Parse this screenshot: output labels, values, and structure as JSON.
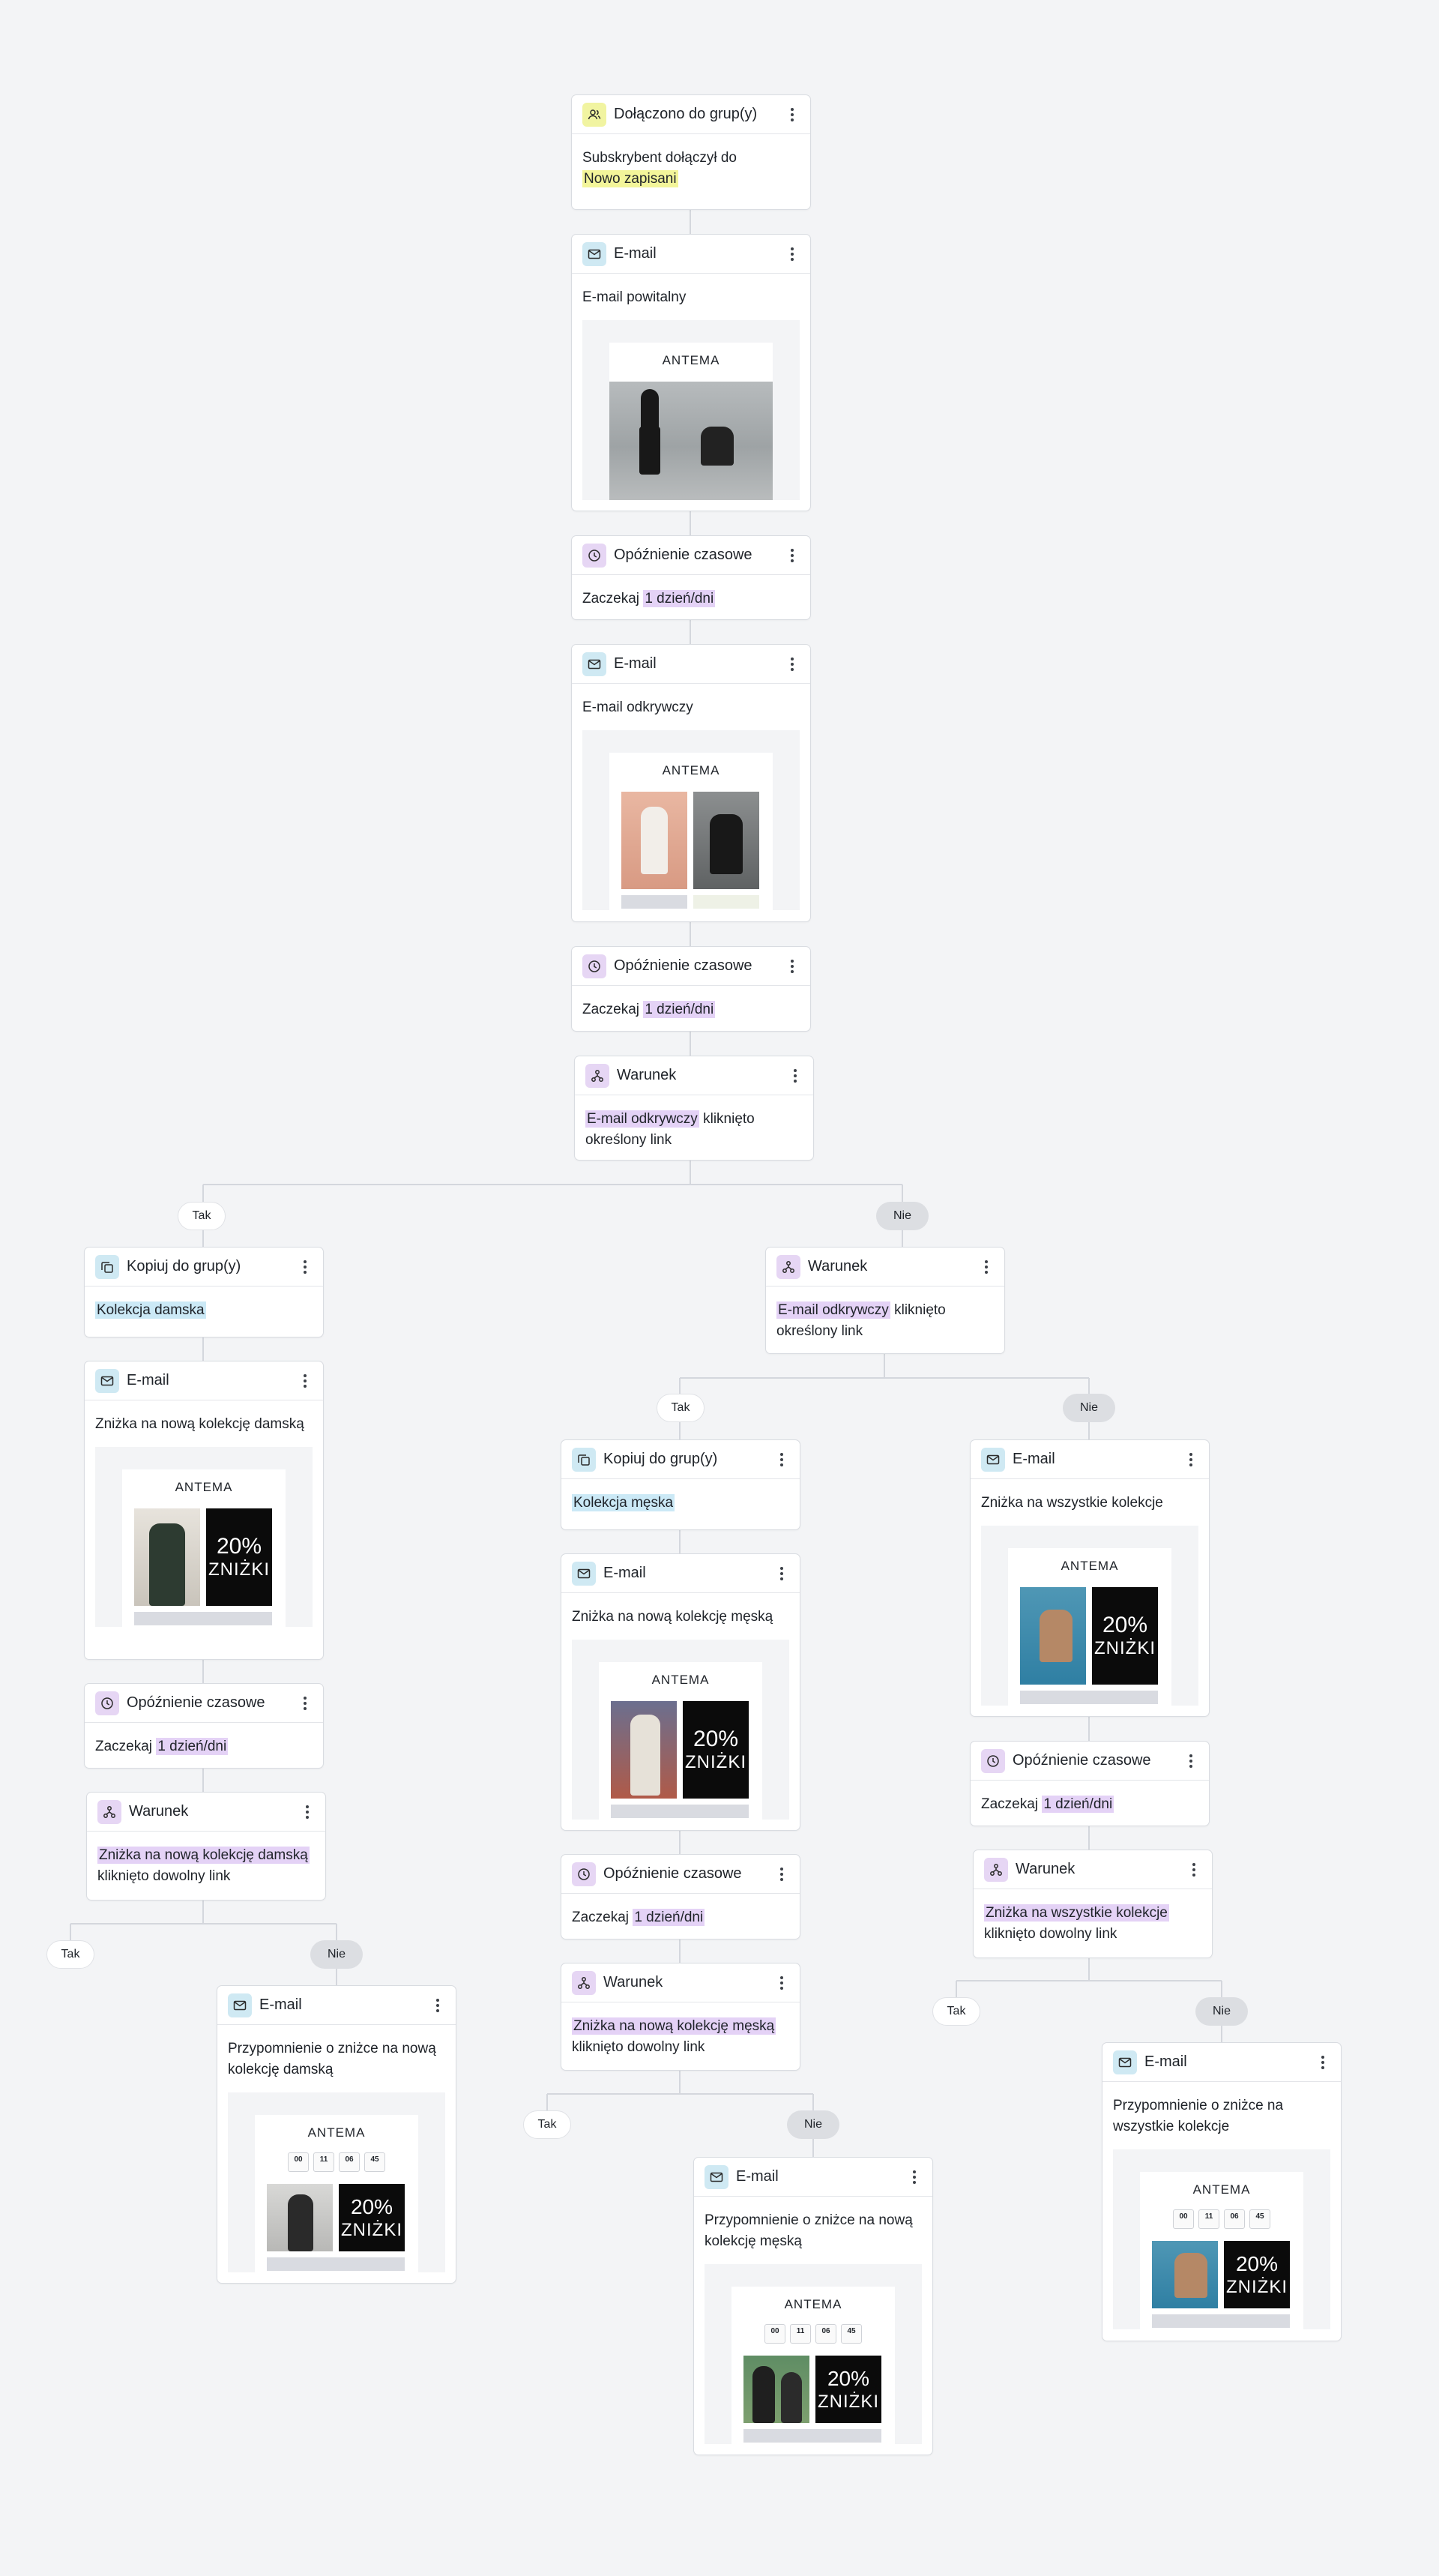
{
  "brand": "ANTEMA",
  "promo": {
    "value": "20%",
    "label": "ZNIŻKI"
  },
  "timer": [
    "00",
    "11",
    "06",
    "45"
  ],
  "branch": {
    "yes": "Tak",
    "no": "Nie"
  },
  "nodes": {
    "n1": {
      "title": "Dołączono do grup(y)",
      "text": "Subskrybent dołączył do",
      "highlight": "Nowo zapisani"
    },
    "n2": {
      "title": "E-mail",
      "text": "E-mail powitalny"
    },
    "n3": {
      "title": "Opóźnienie czasowe",
      "text": "Zaczekaj",
      "highlight": "1 dzień/dni"
    },
    "n4": {
      "title": "E-mail",
      "text": "E-mail odkrywczy"
    },
    "n5": {
      "title": "Opóźnienie czasowe",
      "text": "Zaczekaj",
      "highlight": "1 dzień/dni"
    },
    "n6": {
      "title": "Warunek",
      "highlight": "E-mail odkrywczy",
      "text": "kliknięto określony link"
    },
    "a1": {
      "title": "Kopiuj do grup(y)",
      "highlight": "Kolekcja damska"
    },
    "a2": {
      "title": "E-mail",
      "text": "Zniżka na nową kolekcję damską"
    },
    "a3": {
      "title": "Opóźnienie czasowe",
      "text": "Zaczekaj",
      "highlight": "1 dzień/dni"
    },
    "a4": {
      "title": "Warunek",
      "highlight": "Zniżka na nową kolekcję damską",
      "text": "kliknięto dowolny link"
    },
    "a5": {
      "title": "E-mail",
      "text": "Przypomnienie o zniżce na nową kolekcję damską"
    },
    "b0": {
      "title": "Warunek",
      "highlight": "E-mail odkrywczy",
      "text": "kliknięto określony link"
    },
    "b1": {
      "title": "Kopiuj do grup(y)",
      "highlight": "Kolekcja męska"
    },
    "b2": {
      "title": "E-mail",
      "text": "Zniżka na nową kolekcję męską"
    },
    "b3": {
      "title": "Opóźnienie czasowe",
      "text": "Zaczekaj",
      "highlight": "1 dzień/dni"
    },
    "b4": {
      "title": "Warunek",
      "highlight": "Zniżka na nową kolekcję męską",
      "text": "kliknięto dowolny link"
    },
    "b5": {
      "title": "E-mail",
      "text": "Przypomnienie o zniżce na nową kolekcję męską"
    },
    "c1": {
      "title": "E-mail",
      "text": "Zniżka na wszystkie kolekcje"
    },
    "c2": {
      "title": "Opóźnienie czasowe",
      "text": "Zaczekaj",
      "highlight": "1 dzień/dni"
    },
    "c3": {
      "title": "Warunek",
      "highlight": "Zniżka na wszystkie kolekcje",
      "text": "kliknięto dowolny link"
    },
    "c4": {
      "title": "E-mail",
      "text": "Przypomnienie o zniżce na wszystkie kolekcje"
    }
  }
}
